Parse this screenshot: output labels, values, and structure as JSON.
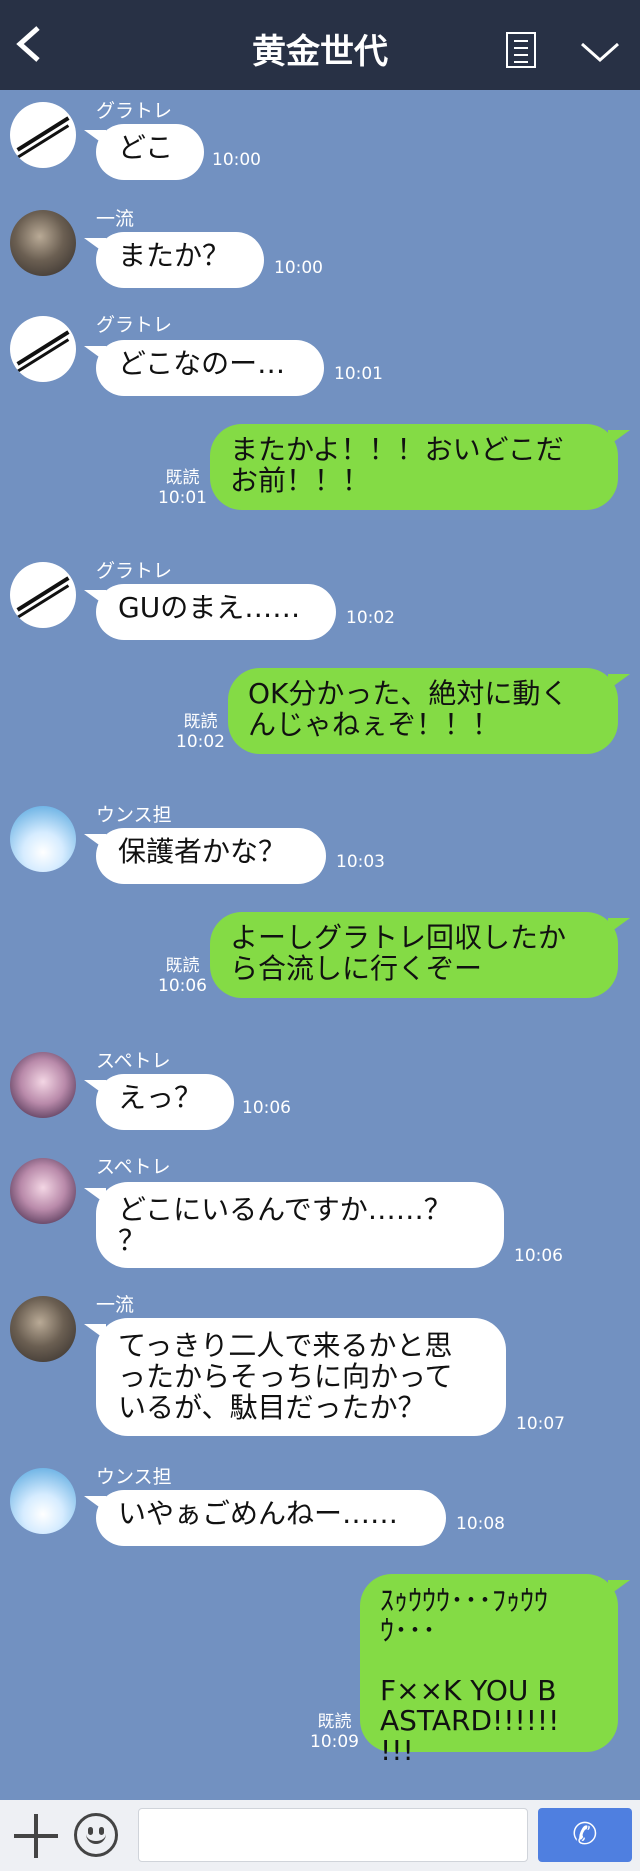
{
  "header": {
    "title": "黄金世代",
    "back_icon": "chevron-left-icon",
    "memo_icon": "note-list-icon",
    "menu_icon": "chevron-down-icon",
    "bg_color": "#283145"
  },
  "chat": {
    "bg_color": "#7291c1",
    "incoming_bubble_color": "#ffffff",
    "outgoing_bubble_color": "#84db45",
    "messages": [
      {
        "sender": "グラトレ",
        "text": "どこ",
        "time": "10:00"
      },
      {
        "sender": "一流",
        "text": "またか？",
        "time": "10:00"
      },
      {
        "sender": "グラトレ",
        "text": "どこなのー…",
        "time": "10:01"
      },
      {
        "text": "またかよ！！！おいどこだ\nお前！！！",
        "read": "既読",
        "time": "10:01"
      },
      {
        "sender": "グラトレ",
        "text": "GUのまえ……",
        "time": "10:02"
      },
      {
        "text": "OK分かった、絶対に動く\nんじゃねぇぞ！！！",
        "read": "既読",
        "time": "10:02"
      },
      {
        "sender": "ウンス担",
        "text": "保護者かな？",
        "time": "10:03"
      },
      {
        "text": "よーしグラトレ回収したか\nら合流しに行くぞー",
        "read": "既読",
        "time": "10:06"
      },
      {
        "sender": "スペトレ",
        "text": "えっ？",
        "time": "10:06"
      },
      {
        "sender": "スペトレ",
        "text": "どこにいるんですか……？\n？",
        "time": "10:06"
      },
      {
        "sender": "一流",
        "text": "てっきり二人で来るかと思\nったからそっちに向かって\nいるが、駄目だったか？",
        "time": "10:07"
      },
      {
        "sender": "ウンス担",
        "text": "いやぁごめんねー……",
        "time": "10:08"
      },
      {
        "text": "ｽｩｳｳｳ･･･ﾌｩｳｳｳ･･･\n\nF××K YOU B\nASTARD!!!!!!\n!!!",
        "read": "既読",
        "time": "10:09"
      }
    ]
  },
  "footer": {
    "plus_icon": "plus-icon",
    "emoji_icon": "smiley-icon",
    "call_icon": "phone-icon",
    "call_glyph": "✆",
    "input_placeholder": ""
  }
}
